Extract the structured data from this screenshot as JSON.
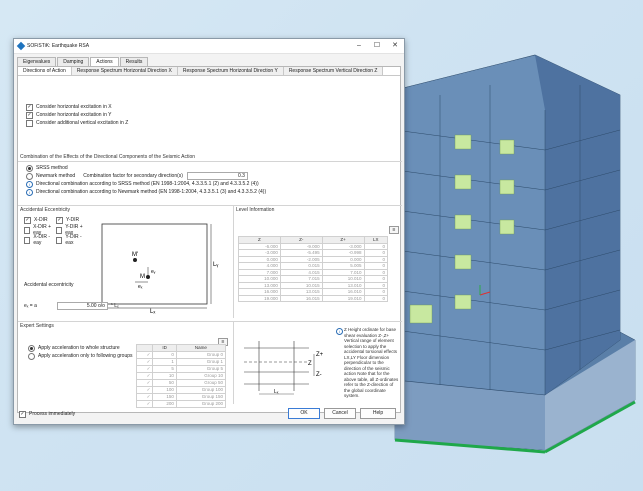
{
  "window": {
    "title": "SOFiSTiK: Earthquake RSA"
  },
  "tabs": [
    "Eigenvalues",
    "Damping",
    "Actions",
    "Results"
  ],
  "subtabs": [
    "Directions of Action",
    "Response Spectrum Horizontal Direction X",
    "Response Spectrum Horizontal Direction Y",
    "Response Spectrum Vertical Direction Z"
  ],
  "directions": {
    "cb_x": "Consider horizontal excitation in X",
    "cb_y": "Consider horizontal excitation in Y",
    "cb_z": "Consider additional vertical excitation in Z"
  },
  "combination": {
    "title": "Combination of the Effects of the Directional Components of the Seismic Action",
    "srss": "SRSS method",
    "newmark": "Newmark method",
    "factor_label": "Combination factor for secondary direction(s)",
    "factor_value": "0.3",
    "info1": "Directional combination according to SRSS method (EN 1998-1:2004, 4.3.3.5.1 (2) and 4.3.3.5.2 (4))",
    "info2": "Directional combination according to Newmark method (EN 1998-1:2004, 4.3.3.5.1 (3) and 4.3.3.5.2 (4))"
  },
  "accidental": {
    "title": "Accidental Eccentricity",
    "opts": [
      "X-DIR",
      "Y-DIR",
      "X-DIR + eay",
      "Y-DIR + eax",
      "X-DIR - eay",
      "Y-DIR - eax"
    ],
    "label": "Accidental eccentricity",
    "ex_label": "eₓ = a",
    "ex_value": "5.00 o/o",
    "ex_unit": "* Lₓ",
    "fig_m": "M",
    "fig_mp": "M'",
    "fig_ex": "eₓ",
    "fig_ey": "eᵧ",
    "fig_lx": "Lₓ",
    "fig_ly": "Lᵧ"
  },
  "level": {
    "title": "Level Information",
    "headers": [
      "Z",
      "Z-",
      "Z+",
      "LX"
    ],
    "rows": [
      [
        "-6.000",
        "-9.000",
        "-3.000",
        "0"
      ],
      [
        "-3.000",
        "-5.495",
        "-0.998",
        "0"
      ],
      [
        "0.000",
        "-2.005",
        "0.000",
        "0"
      ],
      [
        "4.000",
        "0.015",
        "5.005",
        "0"
      ],
      [
        "7.000",
        "4.015",
        "7.010",
        "0"
      ],
      [
        "10.000",
        "7.015",
        "10.010",
        "0"
      ],
      [
        "13.000",
        "10.015",
        "13.010",
        "0"
      ],
      [
        "16.000",
        "13.015",
        "16.010",
        "0"
      ],
      [
        "19.000",
        "16.015",
        "19.010",
        "0"
      ]
    ],
    "note": "Z Height ordinate for base shear evaluation Z-,Z+ Vertical range of element selection to apply the accidental torsional effects LX,LY Floor dimension perpendicular to the direction of the seismic action Note that for the above table, all Z-ordinates refer to the Z-direction of the global coordinate system.",
    "fig_zp": "Z+",
    "fig_z": "Z",
    "fig_zm": "Z-",
    "fig_lx": "Lₓ"
  },
  "expert": {
    "title": "Expert Settings",
    "radio1": "Apply acceleration to whole structure",
    "radio2": "Apply acceleration only to following groups",
    "headers": [
      "",
      "ID",
      "Name"
    ],
    "groups": [
      [
        "0",
        "Group 0"
      ],
      [
        "1",
        "Group 1"
      ],
      [
        "5",
        "Group 5"
      ],
      [
        "10",
        "Group 10"
      ],
      [
        "50",
        "Group 50"
      ],
      [
        "100",
        "Group 100"
      ],
      [
        "150",
        "Group 150"
      ],
      [
        "200",
        "Group 200"
      ]
    ]
  },
  "footer": {
    "process": "Process immediately",
    "ok": "OK",
    "cancel": "Cancel",
    "help": "Help"
  }
}
